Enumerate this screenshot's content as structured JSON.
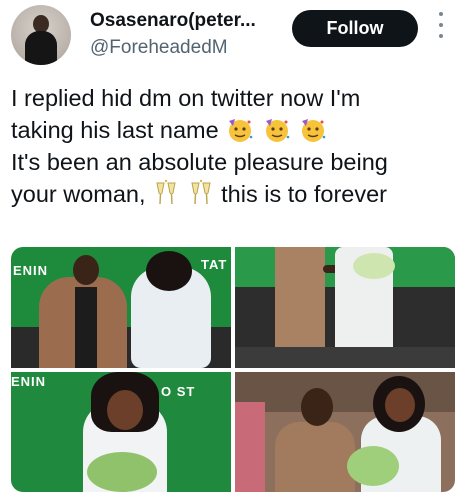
{
  "user": {
    "display_name": "Osasenaro(peter...",
    "handle": "@ForeheadedM"
  },
  "actions": {
    "follow_label": "Follow"
  },
  "tweet": {
    "line1": "I replied hid dm on twitter now I'm",
    "line2_text": "taking his last name",
    "line3": "It's been an absolute pleasure being",
    "line4_a": "your woman,",
    "line4_b": "this is to forever",
    "emojis": [
      "partying-face-emoji",
      "partying-face-emoji",
      "partying-face-emoji",
      "clinking-glasses-emoji",
      "clinking-glasses-emoji"
    ]
  },
  "media": {
    "banner_top_left": "ENIN",
    "banner_top_left_right": "TAT",
    "banner_bottom_left": "ENIN",
    "banner_bottom_left_right": "O ST"
  },
  "colors": {
    "follow_bg": "#0f1419",
    "handle": "#536471",
    "banner_green": "#1e8a3c"
  }
}
